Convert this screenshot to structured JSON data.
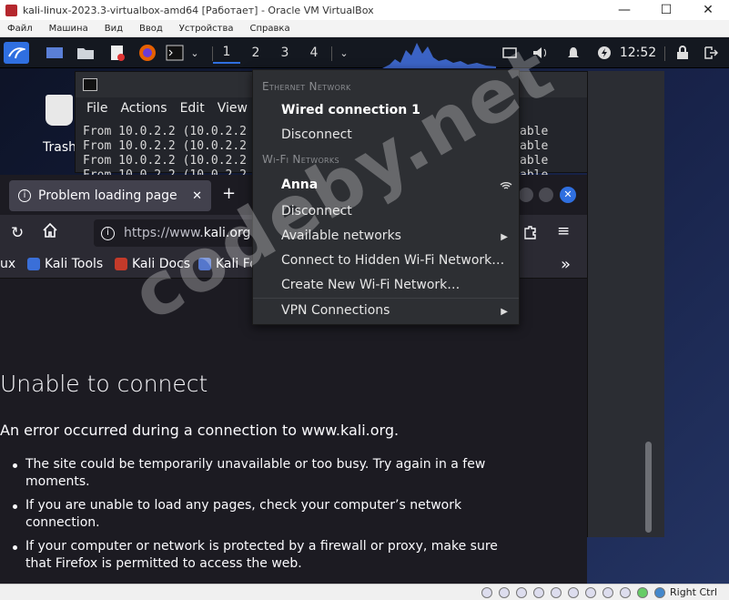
{
  "vbox": {
    "title": "kali-linux-2023.3-virtualbox-amd64 [Работает] - Oracle VM VirtualBox",
    "menu": [
      "Файл",
      "Машина",
      "Вид",
      "Ввод",
      "Устройства",
      "Справка"
    ],
    "minimize": "—",
    "maximize": "☐",
    "close": "✕",
    "host_key": "Right Ctrl"
  },
  "panel": {
    "workspaces": [
      "1",
      "2",
      "3",
      "4"
    ],
    "clock": "12:52"
  },
  "desktop": {
    "trash_label": "Trash"
  },
  "terminal": {
    "menu": [
      "File",
      "Actions",
      "Edit",
      "View"
    ],
    "lines": [
      "From 10.0.2.2 (10.0.2.2",
      "From 10.0.2.2 (10.0.2.2",
      "From 10.0.2.2 (10.0.2.2",
      "From 10.0.2.2 (10.0.2.2"
    ],
    "tail": [
      "able",
      "able",
      "able",
      "able"
    ]
  },
  "firefox": {
    "tab_title": "Problem loading page",
    "url_prefix": "https://www.",
    "url_domain": "kali.org",
    "bookmarks": [
      "Kali Tools",
      "Kali Docs",
      "Kali Fo"
    ],
    "bookmark_left": "ux",
    "error_title": "Unable to connect",
    "error_desc": "An error occurred during a connection to www.kali.org.",
    "reasons": [
      "The site could be temporarily unavailable or too busy. Try again in a few moments.",
      "If you are unable to load any pages, check your computer’s network connection.",
      "If your computer or network is protected by a firewall or proxy, make sure that Firefox is permitted to access the web."
    ]
  },
  "network_menu": {
    "ethernet_header": "Ethernet Network",
    "wired_connection": "Wired connection 1",
    "wired_disconnect": "Disconnect",
    "wifi_header": "Wi-Fi Networks",
    "wifi_name": "Anna",
    "wifi_disconnect": "Disconnect",
    "available_networks": "Available networks",
    "connect_hidden": "Connect to Hidden Wi-Fi Network…",
    "create_new": "Create New Wi-Fi Network…",
    "vpn": "VPN Connections"
  },
  "watermark": "codeby.net",
  "colors": {
    "panel_bg": "#141820",
    "menu_bg": "#2d2f33",
    "firefox_bg": "#1c1b22",
    "accent_blue": "#2f6fe0"
  }
}
